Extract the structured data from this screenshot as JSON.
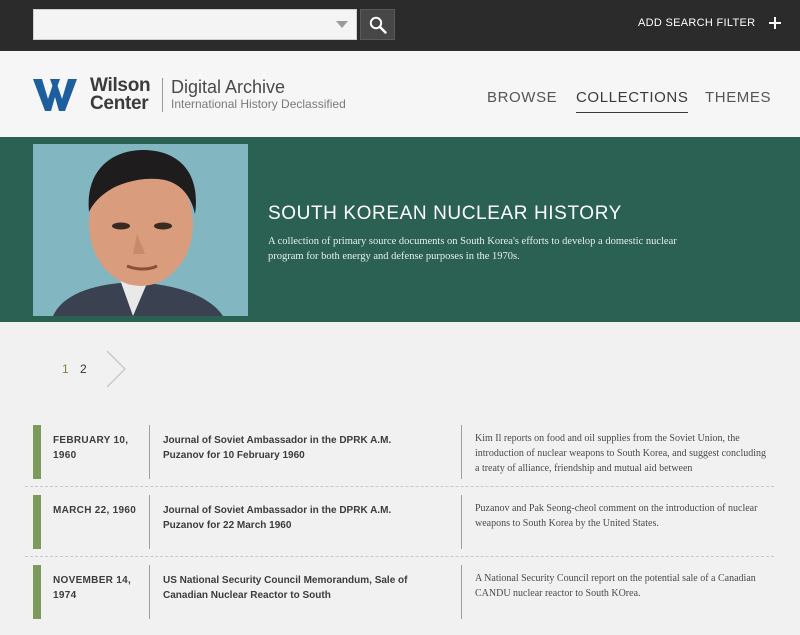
{
  "search": {
    "placeholder": "",
    "value": "",
    "add_filter_label": "ADD SEARCH FILTER"
  },
  "header": {
    "logo_text": "Wilson Center",
    "archive_title": "Digital Archive",
    "archive_subtitle": "International History Declassified",
    "nav": {
      "browse": "BROWSE",
      "collections": "COLLECTIONS",
      "themes": "THEMES"
    }
  },
  "collection": {
    "title": "SOUTH KOREAN NUCLEAR HISTORY",
    "description": " A collection of primary source documents on South Korea's efforts to develop a domestic nuclear program for both energy and defense purposes in the 1970s."
  },
  "pagination": {
    "pages": [
      "1",
      "2"
    ],
    "current": "1"
  },
  "documents": [
    {
      "date": "FEBRUARY 10, 1960",
      "title": "Journal of Soviet Ambassador in the DPRK A.M. Puzanov for 10 February 1960",
      "summary": "Kim Il reports on food and oil supplies from the Soviet Union, the introduction of nuclear weapons to South Korea, and suggest concluding a treaty of alliance, friendship and mutual aid between"
    },
    {
      "date": "MARCH 22, 1960",
      "title": "Journal of Soviet Ambassador in the DPRK A.M. Puzanov for 22 March 1960",
      "summary": "Puzanov and Pak Seong-cheol comment on the introduction of nuclear weapons to South Korea by the United States."
    },
    {
      "date": "NOVEMBER 14, 1974",
      "title": "US National Security Council Memorandum, Sale of Canadian Nuclear Reactor to South",
      "summary": "A National Security Council report on the potential sale of a Canadian CANDU nuclear reactor to South KOrea."
    }
  ],
  "colors": {
    "topbar": "#2b2b2b",
    "banner": "#2b6153",
    "accent_bar": "#7c9a5b",
    "active_page": "#8a7a3a"
  },
  "icons": {
    "search": "search-icon",
    "add_filter": "plus-icon",
    "next_page": "chevron-right-icon",
    "dropdown": "chevron-down-icon"
  }
}
